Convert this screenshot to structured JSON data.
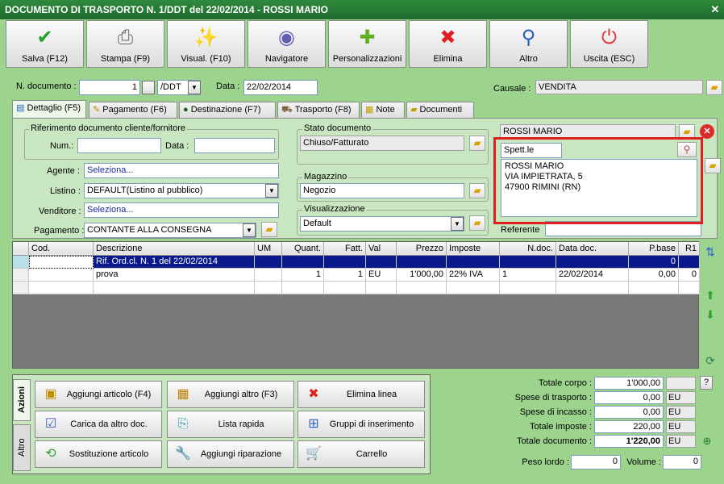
{
  "window": {
    "title": "DOCUMENTO DI TRASPORTO N. 1/DDT del 22/02/2014 - ROSSI MARIO",
    "close": "✕"
  },
  "toolbar": [
    {
      "label": "Salva (F12)",
      "icon": "✔",
      "color": "#2aa02a"
    },
    {
      "label": "Stampa (F9)",
      "icon": "⎙",
      "color": "#666666"
    },
    {
      "label": "Visual. (F10)",
      "icon": "✨",
      "color": "#d09000"
    },
    {
      "label": "Navigatore",
      "icon": "◉",
      "color": "#6060b0"
    },
    {
      "label": "Personalizzazioni",
      "icon": "✚",
      "color": "#60b020"
    },
    {
      "label": "Elimina",
      "icon": "✖",
      "color": "#e02020"
    },
    {
      "label": "Altro",
      "icon": "⚲",
      "color": "#2060c0"
    },
    {
      "label": "Uscita (ESC)",
      "icon": "⏻",
      "color": "#e03030"
    }
  ],
  "header": {
    "ndoc_label": "N. documento :",
    "ndoc_value": "1",
    "series_value": "/DDT",
    "data_label": "Data :",
    "data_value": "22/02/2014",
    "causale_label": "Causale :",
    "causale_value": "VENDITA"
  },
  "tabs": [
    "Dettaglio (F5)",
    "Pagamento (F6)",
    "Destinazione (F7)",
    "Trasporto (F8)",
    "Note",
    "Documenti"
  ],
  "dettaglio": {
    "rif_title": "Riferimento documento cliente/fornitore",
    "num_label": "Num.:",
    "num_value": "",
    "data_label": "Data :",
    "data_value": "",
    "agente_label": "Agente :",
    "agente_value": "Seleziona...",
    "listino_label": "Listino :",
    "listino_value": "DEFAULT(Listino al pubblico)",
    "venditore_label": "Venditore :",
    "venditore_value": "Seleziona...",
    "pagamento_label": "Pagamento :",
    "pagamento_value": "CONTANTE ALLA CONSEGNA",
    "stato_title": "Stato documento",
    "stato_value": "Chiuso/Fatturato",
    "magazzino_title": "Magazzino",
    "magazzino_value": "Negozio",
    "visual_title": "Visualizzazione",
    "visual_value": "Default"
  },
  "cliente": {
    "name": "ROSSI MARIO",
    "title_value": "Spett.le",
    "address": [
      "ROSSI MARIO",
      "VIA IMPIETRATA, 5",
      "47900 RIMINI (RN)"
    ],
    "referente_label": "Referente",
    "referente_value": ""
  },
  "grid": {
    "headers": [
      "Cod.",
      "Descrizione",
      "UM",
      "Quant.",
      "Fatt.",
      "Val",
      "Prezzo",
      "Imposte",
      "N.doc.",
      "Data doc.",
      "P.base",
      "R1"
    ],
    "rows": [
      [
        "",
        "Rif. Ord.cl. N. 1 del 22/02/2014",
        "",
        "",
        "",
        "",
        "",
        "",
        "",
        "",
        "0",
        ""
      ],
      [
        "",
        "prova",
        "",
        "1",
        "1",
        "EU",
        "1'000,00",
        "22% IVA",
        "1",
        "22/02/2014",
        "0,00",
        "0"
      ],
      [
        "",
        "",
        "",
        "",
        "",
        "",
        "",
        "",
        "",
        "",
        "",
        ""
      ]
    ]
  },
  "actions": {
    "tab_azioni": "Azioni",
    "tab_altro": "Altro",
    "buttons": [
      [
        "Aggiungi articolo (F4)",
        "Aggiungi altro (F3)",
        "Elimina linea"
      ],
      [
        "Carica da altro doc.",
        "Lista rapida",
        "Gruppi di inserimento"
      ],
      [
        "Sostituzione articolo",
        "Aggiungi riparazione",
        "Carrello"
      ]
    ]
  },
  "totals": {
    "corpo_label": "Totale corpo :",
    "corpo_value": "1'000,00",
    "help": "?",
    "trasporto_label": "Spese di trasporto :",
    "trasporto_value": "0,00",
    "trasporto_cur": "EU",
    "incasso_label": "Spese di incasso :",
    "incasso_value": "0,00",
    "incasso_cur": "EU",
    "imposte_label": "Totale imposte :",
    "imposte_value": "220,00",
    "imposte_cur": "EU",
    "documento_label": "Totale documento :",
    "documento_value": "1'220,00",
    "documento_cur": "EU",
    "peso_label": "Peso lordo :",
    "peso_value": "0",
    "volume_label": "Volume :",
    "volume_value": "0"
  }
}
